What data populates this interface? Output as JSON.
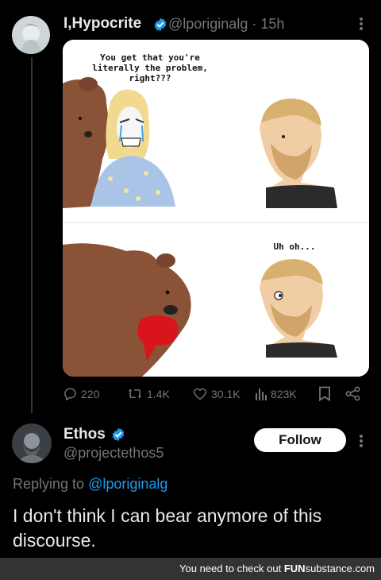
{
  "tweet": {
    "author": "I,Hypocrite",
    "handle": "@lporiginalg",
    "time": "· 15h",
    "meme": {
      "panel1_caption": "You get that you're\nliterally the problem,\nright???",
      "panel2_caption": "Uh oh..."
    },
    "stats": {
      "replies": "220",
      "reposts": "1.4K",
      "likes": "30.1K",
      "views": "823K"
    }
  },
  "reply": {
    "author": "Ethos",
    "handle": "@projectethos5",
    "follow_label": "Follow",
    "replying_prefix": "Replying to",
    "replying_to": "@lporiginalg",
    "text": "I don't think I can bear anymore of this discourse."
  },
  "banner": {
    "prefix": "You need to check out",
    "brand_fun": "FUN",
    "brand_substance": "substance",
    "brand_suffix": ".com"
  },
  "colors": {
    "accent": "#1d9bf0",
    "muted": "#71767b",
    "background": "#000000"
  }
}
